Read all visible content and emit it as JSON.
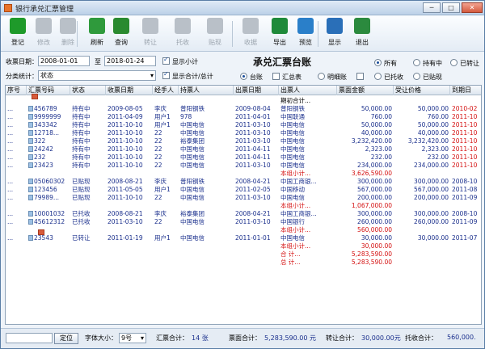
{
  "window": {
    "title": "银行承兑汇票管理",
    "min": "─",
    "max": "□",
    "close": "✕"
  },
  "toolbar": [
    {
      "label": "登记",
      "color": "#1e9a2a",
      "enabled": true
    },
    {
      "label": "修改",
      "color": "#b9c0c8",
      "enabled": false
    },
    {
      "label": "删除",
      "color": "#b9c0c8",
      "enabled": false
    },
    {
      "label": "刷新",
      "color": "#2f9a3c",
      "enabled": true
    },
    {
      "label": "查询",
      "color": "#2a8a2f",
      "enabled": true
    },
    {
      "label": "转让",
      "color": "#b9c0c8",
      "enabled": false
    },
    {
      "label": "托收",
      "color": "#b9c0c8",
      "enabled": false
    },
    {
      "label": "贴现",
      "color": "#b9c0c8",
      "enabled": false
    },
    {
      "label": "收据",
      "color": "#b9c0c8",
      "enabled": false
    },
    {
      "label": "导出",
      "color": "#1f8a3a",
      "enabled": true
    },
    {
      "label": "预览",
      "color": "#2a7fc9",
      "enabled": true
    },
    {
      "label": "显示",
      "color": "#2a6fb8",
      "enabled": true
    },
    {
      "label": "退出",
      "color": "#2b8a3e",
      "enabled": true
    }
  ],
  "filter": {
    "date_label": "收票日期：",
    "date_from": "2008-01-01",
    "to_label": "至",
    "date_to": "2018-01-24",
    "show_subtotal": "显示小计",
    "category_label": "分类统计：",
    "category_value": "状态",
    "show_total": "显示合计/总计",
    "report_title": "承兑汇票台账",
    "view_options": [
      "台账",
      "汇总表",
      "明细账"
    ],
    "status_options": [
      "所有",
      "持有中",
      "已转让",
      "已托收",
      "已贴现"
    ]
  },
  "table": {
    "columns": [
      "序号",
      "汇票号码",
      "状态",
      "收票日期",
      "经手人",
      "持票人",
      "出票日期",
      "出票人",
      "票面金额",
      "受让价格",
      "到期日"
    ],
    "rows": [
      {
        "kind": "carry",
        "drawer": "期初合计..."
      },
      {
        "seq": "...",
        "no": "456789",
        "status": "持有中",
        "recv": "2009-08-05",
        "handler": "李庆",
        "holder": "普阳钢铁",
        "issue": "2009-08-04",
        "drawer": "普阳钢铁",
        "amount": "50,000.00",
        "price": "50,000.00",
        "due": "2010-02",
        "due_red": true
      },
      {
        "seq": "...",
        "no": "9999999",
        "status": "持有中",
        "recv": "2011-04-09",
        "handler": "用户1",
        "holder": "978",
        "issue": "2011-04-01",
        "drawer": "中国联通",
        "amount": "760.00",
        "price": "760.00",
        "due": "2011-10",
        "due_red": true
      },
      {
        "seq": "...",
        "no": "343342",
        "status": "持有中",
        "recv": "2011-10-10",
        "handler": "用户1",
        "holder": "中国电信",
        "issue": "2011-03-10",
        "drawer": "中国电信",
        "amount": "50,000.00",
        "price": "50,000.00",
        "due": "2011-10",
        "due_red": true
      },
      {
        "seq": "...",
        "no": "12718...",
        "status": "持有中",
        "recv": "2011-10-10",
        "handler": "22",
        "holder": "中国电信",
        "issue": "2011-03-10",
        "drawer": "中国电信",
        "amount": "40,000.00",
        "price": "40,000.00",
        "due": "2011-10",
        "due_red": true
      },
      {
        "seq": "...",
        "no": "322",
        "status": "持有中",
        "recv": "2011-10-10",
        "handler": "22",
        "holder": "裕泰集团",
        "issue": "2011-03-10",
        "drawer": "中国电信",
        "amount": "3,232,420.00",
        "price": "3,232,420.00",
        "due": "2011-10",
        "due_red": true
      },
      {
        "seq": "...",
        "no": "24242",
        "status": "持有中",
        "recv": "2011-10-10",
        "handler": "22",
        "holder": "中国电信",
        "issue": "2011-04-11",
        "drawer": "中国电信",
        "amount": "2,323.00",
        "price": "2,323.00",
        "due": "2011-10",
        "due_red": true
      },
      {
        "seq": "...",
        "no": "232",
        "status": "持有中",
        "recv": "2011-10-10",
        "handler": "22",
        "holder": "中国电信",
        "issue": "2011-04-11",
        "drawer": "中国电信",
        "amount": "232.00",
        "price": "232.00",
        "due": "2011-10",
        "due_red": true
      },
      {
        "seq": "...",
        "no": "23423",
        "status": "持有中",
        "recv": "2011-10-10",
        "handler": "22",
        "holder": "中国电信",
        "issue": "2011-03-10",
        "drawer": "中国电信",
        "amount": "234,000.00",
        "price": "234,000.00",
        "due": "2011-10",
        "due_red": true
      },
      {
        "kind": "sub",
        "drawer": "本组小计...",
        "amount": "3,626,590.00"
      },
      {
        "seq": "...",
        "no": "05060302",
        "status": "已贴现",
        "recv": "2008-08-21",
        "handler": "李庆",
        "holder": "普阳钢铁",
        "issue": "2008-04-21",
        "drawer": "中国工商银...",
        "amount": "300,000.00",
        "price": "300,000.00",
        "due": "2008-10",
        "due_red": false
      },
      {
        "seq": "...",
        "no": "123456",
        "status": "已贴现",
        "recv": "2011-05-05",
        "handler": "用户1",
        "holder": "中国电信",
        "issue": "2011-02-05",
        "drawer": "中国移动",
        "amount": "567,000.00",
        "price": "567,000.00",
        "due": "2011-08",
        "due_red": false
      },
      {
        "seq": "...",
        "no": "79989...",
        "status": "已贴现",
        "recv": "2011-10-10",
        "handler": "22",
        "holder": "中国电信",
        "issue": "2011-03-10",
        "drawer": "中国电信",
        "amount": "200,000.00",
        "price": "200,000.00",
        "due": "2011-09",
        "due_red": false
      },
      {
        "kind": "sub",
        "drawer": "本组小计...",
        "amount": "1,067,000.00"
      },
      {
        "seq": "...",
        "no": "10001032",
        "status": "已托收",
        "recv": "2008-08-21",
        "handler": "李庆",
        "holder": "裕泰集团",
        "issue": "2008-04-21",
        "drawer": "中国工商银...",
        "amount": "300,000.00",
        "price": "300,000.00",
        "due": "2008-10",
        "due_red": false
      },
      {
        "seq": "...",
        "no": "45612312",
        "status": "已托收",
        "recv": "2011-03-10",
        "handler": "22",
        "holder": "中国电信",
        "issue": "2011-03-10",
        "drawer": "中国银行",
        "amount": "260,000.00",
        "price": "260,000.00",
        "due": "2011-09",
        "due_red": false
      },
      {
        "kind": "sub",
        "drawer": "本组小计...",
        "amount": "560,000.00"
      },
      {
        "seq": "...",
        "no": "23543",
        "status": "已转让",
        "recv": "2011-01-19",
        "handler": "用户1",
        "holder": "中国电信",
        "issue": "2011-01-01",
        "drawer": "中国电信",
        "amount": "30,000.00",
        "price": "30,000.00",
        "due": "2011-07",
        "due_red": false
      },
      {
        "kind": "sub",
        "drawer": "本组小计...",
        "amount": "30,000.00"
      },
      {
        "kind": "sub",
        "drawer": "合    计...",
        "amount": "5,283,590.00"
      },
      {
        "kind": "sub",
        "drawer": "总    计...",
        "amount": "5,283,590.00"
      }
    ]
  },
  "status": {
    "locate_button": "定位",
    "font_label": "字体大小：",
    "font_value": "9号",
    "count_label": "汇票合计：",
    "count_value": "14 张",
    "face_label": "票面合计：",
    "face_value": "5,283,590.00 元",
    "transfer_label": "转让合计：",
    "transfer_value": "30,000.00元",
    "collect_label": "托收合计：",
    "collect_value": "560,000."
  }
}
